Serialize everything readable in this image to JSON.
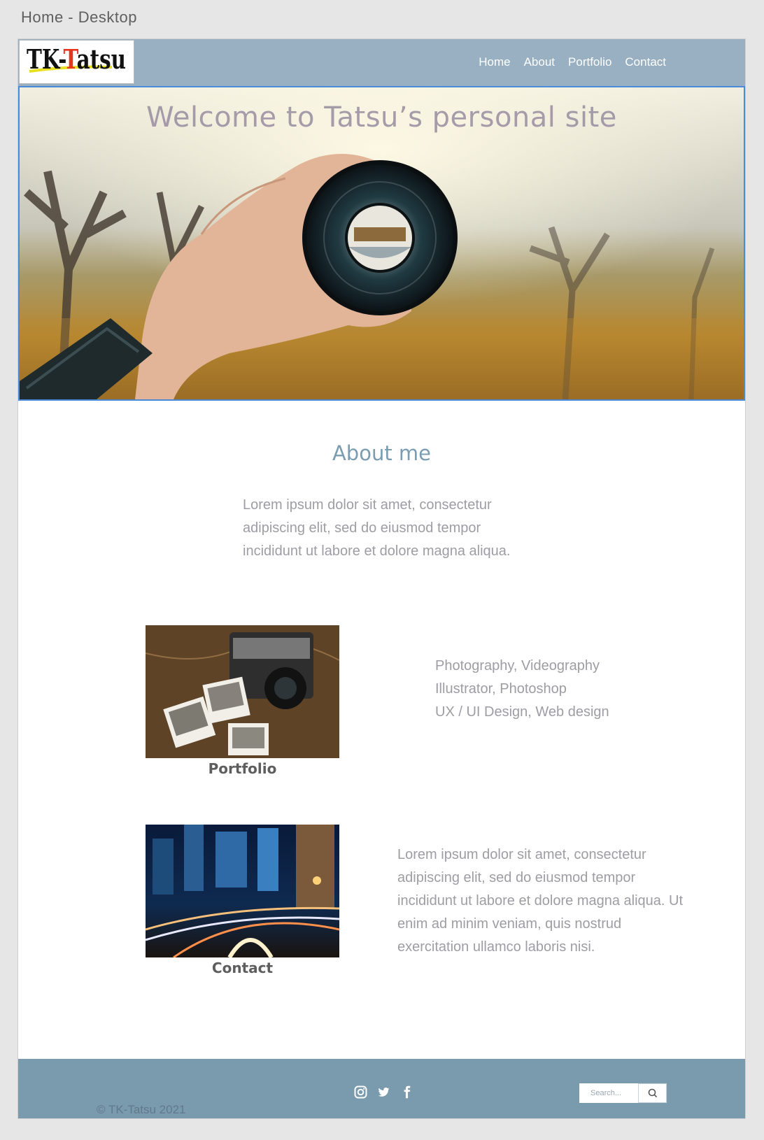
{
  "artboard": {
    "label": "Home - Desktop"
  },
  "header": {
    "logo_text": "TK-Tatsu",
    "nav": [
      "Home",
      "About",
      "Portfolio",
      "Contact"
    ]
  },
  "hero": {
    "title": "Welcome to Tatsu’s personal site"
  },
  "about": {
    "heading": "About me",
    "text": "Lorem ipsum dolor sit amet, consectetur adipiscing elit, sed do eiusmod tempor incididunt ut labore et dolore magna aliqua."
  },
  "portfolio": {
    "caption": "Portfolio",
    "skills": [
      "Photography, Videography",
      "Illustrator, Photoshop",
      "UX / UI Design, Web design"
    ]
  },
  "contact": {
    "caption": "Contact",
    "text": "Lorem ipsum dolor sit amet, consectetur adipiscing elit, sed do eiusmod tempor incididunt ut labore et dolore magna aliqua. Ut enim ad minim veniam, quis nostrud exercitation ullamco laboris nisi."
  },
  "footer": {
    "search_placeholder": "Search...",
    "copyright": "© TK-Tatsu 2021",
    "social_icons": [
      "instagram-icon",
      "twitter-icon",
      "facebook-icon"
    ]
  },
  "colors": {
    "header_bg": "#98b0c1",
    "footer_bg": "#7a9aae",
    "accent_heading": "#7a9db2",
    "body_text": "#9d9da4"
  }
}
